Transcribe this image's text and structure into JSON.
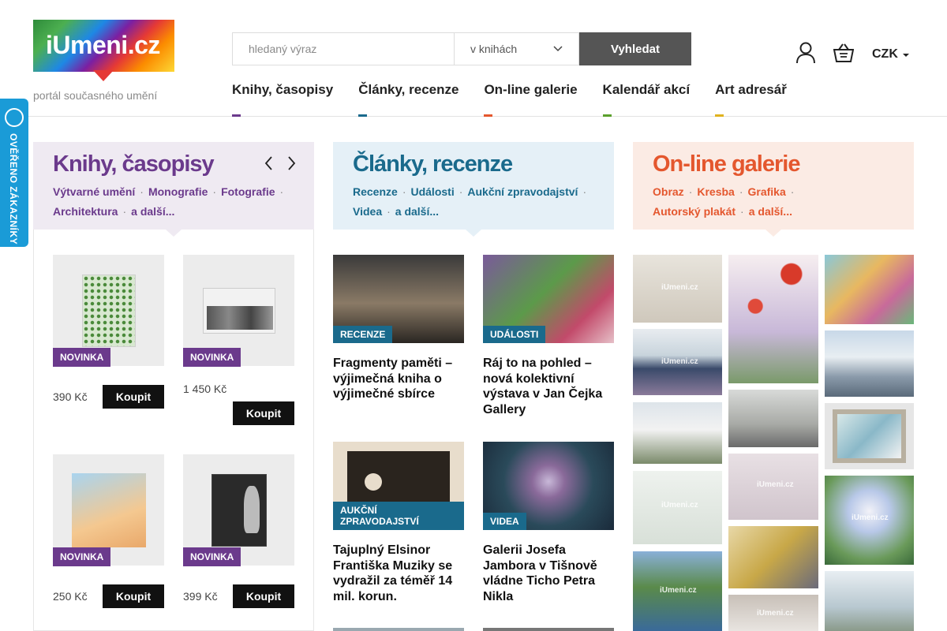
{
  "brand": {
    "logo_text": "iUmeni.cz",
    "tagline": "portál současného umění"
  },
  "search": {
    "placeholder": "hledaný výraz",
    "scope": "v knihách",
    "button": "Vyhledat"
  },
  "header": {
    "currency": "CZK"
  },
  "nav": [
    {
      "label": "Knihy, časopisy",
      "color": "#6b3a8c"
    },
    {
      "label": "Články, recenze",
      "color": "#1a6a8c"
    },
    {
      "label": "On-line galerie",
      "color": "#e4572e"
    },
    {
      "label": "Kalendář akcí",
      "color": "#5aa02c"
    },
    {
      "label": "Art adresář",
      "color": "#e0b21e"
    }
  ],
  "verified": {
    "label": "OVĚŘENO ZÁKAZNÍKY"
  },
  "books": {
    "title": "Knihy, časopisy",
    "links": [
      "Výtvarné umění",
      "Monografie",
      "Fotografie",
      "Architektura",
      "a další..."
    ],
    "items": [
      {
        "badge": "NOVINKA",
        "price": "390 Kč",
        "buy": "Koupit"
      },
      {
        "badge": "NOVINKA",
        "price": "1 450 Kč",
        "buy": "Koupit"
      },
      {
        "badge": "NOVINKA",
        "price": "250 Kč",
        "buy": "Koupit"
      },
      {
        "badge": "NOVINKA",
        "price": "399 Kč",
        "buy": "Koupit"
      }
    ]
  },
  "articles": {
    "title": "Články, recenze",
    "links": [
      "Recenze",
      "Události",
      "Aukční zpravodajství",
      "Videa",
      "a další..."
    ],
    "items": [
      {
        "badge": "RECENZE",
        "title": "Fragmenty paměti – výjimečná kniha o výjimečné sbírce"
      },
      {
        "badge": "UDÁLOSTI",
        "title": "Ráj to na pohled – nová kolektivní výstava v Jan Čejka Gallery"
      },
      {
        "badge": "AUKČNÍ ZPRAVODAJSTVÍ",
        "title": "Tajuplný Elsinor Františka Muziky se vydražil za téměř 14 mil. korun."
      },
      {
        "badge": "VIDEA",
        "title": "Galerii Josefa Jambora v Tišnově vládne Ticho Petra Nikla"
      }
    ]
  },
  "gallery": {
    "title": "On-line galerie",
    "links": [
      "Obraz",
      "Kresba",
      "Grafika",
      "Autorský plakát",
      "a další..."
    ],
    "watermark": "iUmeni.cz"
  }
}
